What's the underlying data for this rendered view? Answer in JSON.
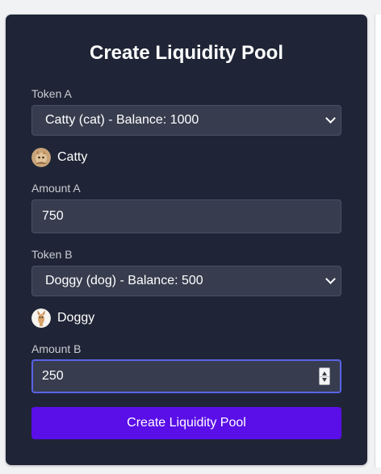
{
  "form": {
    "title": "Create Liquidity Pool",
    "token_a": {
      "label": "Token A",
      "selected": "Catty (cat) - Balance: 1000",
      "name": "Catty",
      "icon": "cat-avatar-icon"
    },
    "amount_a": {
      "label": "Amount A",
      "value": "750"
    },
    "token_b": {
      "label": "Token B",
      "selected": "Doggy (dog) - Balance: 500",
      "name": "Doggy",
      "icon": "dog-avatar-icon"
    },
    "amount_b": {
      "label": "Amount B",
      "value": "250"
    },
    "submit_label": "Create Liquidity Pool"
  },
  "colors": {
    "card_bg": "#1f2536",
    "field_bg": "#373d4f",
    "focus_border": "#5a63e6",
    "primary_button": "#5a0ee8"
  }
}
